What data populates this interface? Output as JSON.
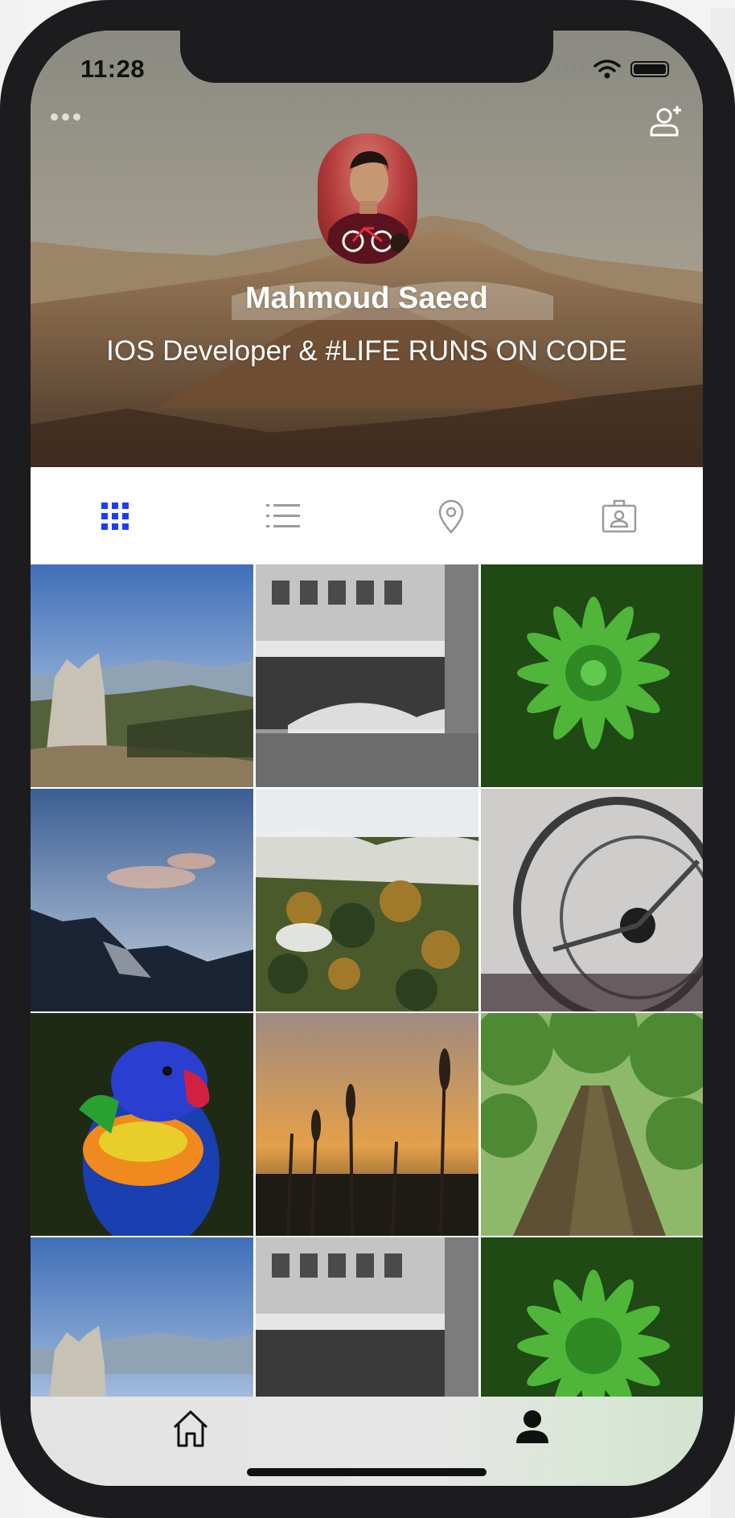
{
  "status_bar": {
    "time": "11:28"
  },
  "profile": {
    "name": "Mahmoud Saeed",
    "bio": "IOS Developer & #LIFE RUNS ON CODE"
  },
  "header_icons": {
    "left": "more-dots-icon",
    "right": "add-user-icon"
  },
  "tabs": [
    {
      "id": "grid",
      "icon": "grid-icon",
      "active": true
    },
    {
      "id": "list",
      "icon": "list-icon",
      "active": false
    },
    {
      "id": "location",
      "icon": "location-pin-icon",
      "active": false
    },
    {
      "id": "tagged",
      "icon": "tagged-user-icon",
      "active": false
    }
  ],
  "photos": [
    {
      "subject": "rocky peaks landscape"
    },
    {
      "subject": "black and white city street"
    },
    {
      "subject": "green succulent plant"
    },
    {
      "subject": "mountain range at dusk"
    },
    {
      "subject": "misty forest"
    },
    {
      "subject": "vintage steering wheel"
    },
    {
      "subject": "rainbow lorikeet parrot"
    },
    {
      "subject": "grass at sunset"
    },
    {
      "subject": "tall tree trunk"
    },
    {
      "subject": "rocky peaks landscape"
    },
    {
      "subject": "black and white city street"
    },
    {
      "subject": "green succulent plant"
    }
  ],
  "tab_bar": [
    {
      "id": "home",
      "icon": "home-icon",
      "active": false
    },
    {
      "id": "profile",
      "icon": "profile-icon",
      "active": true
    }
  ],
  "colors": {
    "accent": "#1e3cff",
    "inactive_icon": "#9a9a9a",
    "header_text": "#ffffff"
  }
}
